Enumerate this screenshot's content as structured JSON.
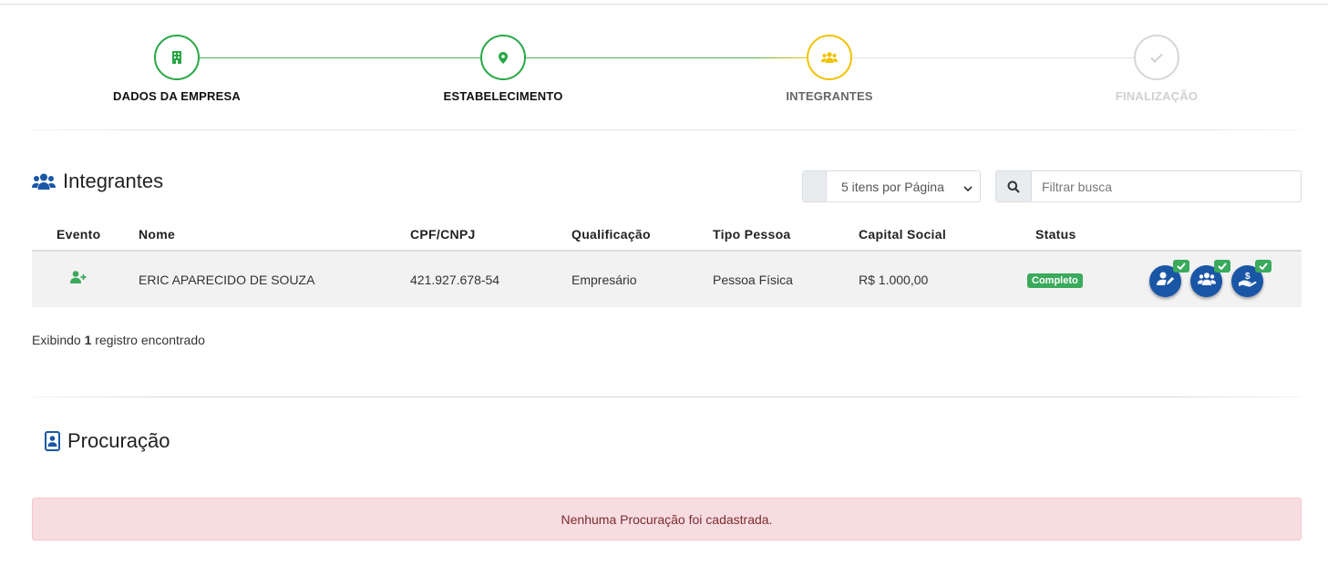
{
  "stepper": {
    "steps": [
      {
        "label": "DADOS DA EMPRESA",
        "icon": "building-icon",
        "state": "done"
      },
      {
        "label": "ESTABELECIMENTO",
        "icon": "map-marker-icon",
        "state": "done"
      },
      {
        "label": "INTEGRANTES",
        "icon": "users-icon",
        "state": "active"
      },
      {
        "label": "FINALIZAÇÃO",
        "icon": "check-icon",
        "state": "pending"
      }
    ]
  },
  "integrantes": {
    "title": "Integrantes",
    "per_page": "5 itens por Página",
    "search_placeholder": "Filtrar busca",
    "columns": [
      "Evento",
      "Nome",
      "CPF/CNPJ",
      "Qualificação",
      "Tipo Pessoa",
      "Capital Social",
      "Status"
    ],
    "rows": [
      {
        "evento_icon": "user-plus-icon",
        "nome": "ERIC APARECIDO DE SOUZA",
        "cpf": "421.927.678-54",
        "qualificacao": "Empresário",
        "tipo": "Pessoa Física",
        "capital": "R$ 1.000,00",
        "status": "Completo"
      }
    ],
    "records_prefix": "Exibindo",
    "records_count": "1",
    "records_suffix": "registro encontrado"
  },
  "procuracao": {
    "title": "Procuração",
    "empty_message": "Nenhuma Procuração foi cadastrada."
  },
  "colors": {
    "done": "#28a745",
    "active": "#f2c200",
    "pending": "#d6d6d6",
    "action_blue": "#1a56a6",
    "badge_green": "#3aaa5c",
    "alert_bg": "#f8dde0"
  }
}
